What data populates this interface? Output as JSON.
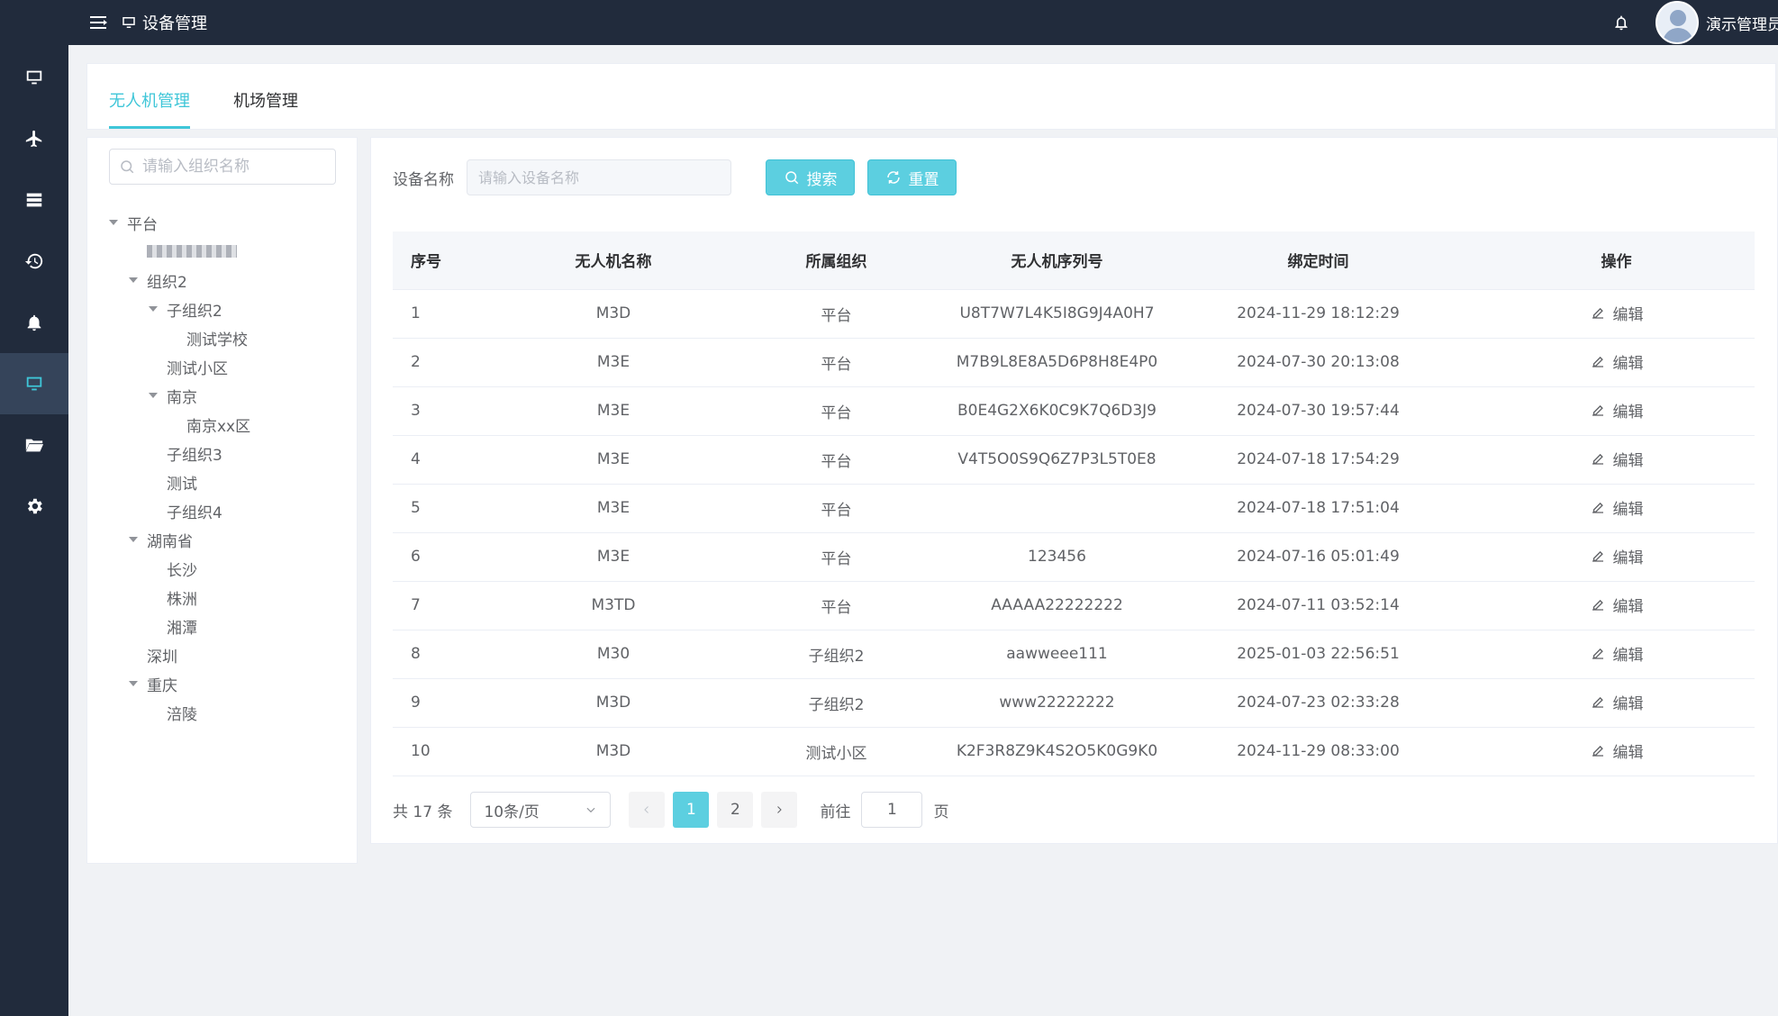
{
  "header": {
    "breadcrumb": "设备管理",
    "username": "演示管理员",
    "icons": [
      "hamburger-icon",
      "monitor-icon",
      "bell-icon",
      "avatar"
    ]
  },
  "sidebar": {
    "items": [
      {
        "icon": "monitor-icon",
        "active": false
      },
      {
        "icon": "plane-icon",
        "active": false
      },
      {
        "icon": "server-icon",
        "active": false
      },
      {
        "icon": "history-icon",
        "active": false
      },
      {
        "icon": "bell-icon",
        "active": false
      },
      {
        "icon": "device-icon",
        "active": true
      },
      {
        "icon": "folder-icon",
        "active": false
      },
      {
        "icon": "gear-icon",
        "active": false
      }
    ]
  },
  "tabs": {
    "items": [
      {
        "label": "无人机管理",
        "active": true
      },
      {
        "label": "机场管理",
        "active": false
      }
    ]
  },
  "tree": {
    "search_placeholder": "请输入组织名称",
    "nodes": [
      {
        "label": "平台",
        "level": 0,
        "expanded": true
      },
      {
        "label": "",
        "level": 1,
        "expanded": false,
        "blurred": true
      },
      {
        "label": "组织2",
        "level": 1,
        "expanded": true
      },
      {
        "label": "子组织2",
        "level": 2,
        "expanded": true
      },
      {
        "label": "测试学校",
        "level": 3
      },
      {
        "label": "测试小区",
        "level": 2
      },
      {
        "label": "南京",
        "level": 2,
        "expanded": true
      },
      {
        "label": "南京xx区",
        "level": 3
      },
      {
        "label": "子组织3",
        "level": 2
      },
      {
        "label": "测试",
        "level": 2
      },
      {
        "label": "子组织4",
        "level": 2
      },
      {
        "label": "湖南省",
        "level": 1,
        "expanded": true
      },
      {
        "label": "长沙",
        "level": 2
      },
      {
        "label": "株洲",
        "level": 2
      },
      {
        "label": "湘潭",
        "level": 2
      },
      {
        "label": "深圳",
        "level": 1
      },
      {
        "label": "重庆",
        "level": 1,
        "expanded": true
      },
      {
        "label": "涪陵",
        "level": 2
      }
    ]
  },
  "filter": {
    "label": "设备名称",
    "placeholder": "请输入设备名称",
    "search_label": "搜索",
    "reset_label": "重置"
  },
  "table": {
    "columns": [
      "序号",
      "无人机名称",
      "所属组织",
      "无人机序列号",
      "绑定时间",
      "操作"
    ],
    "edit_label": "编辑",
    "rows": [
      {
        "idx": "1",
        "name": "M3D",
        "org": "平台",
        "serial": "U8T7W7L4K5I8G9J4A0H7",
        "time": "2024-11-29 18:12:29"
      },
      {
        "idx": "2",
        "name": "M3E",
        "org": "平台",
        "serial": "M7B9L8E8A5D6P8H8E4P0",
        "time": "2024-07-30 20:13:08"
      },
      {
        "idx": "3",
        "name": "M3E",
        "org": "平台",
        "serial": "B0E4G2X6K0C9K7Q6D3J9",
        "time": "2024-07-30 19:57:44"
      },
      {
        "idx": "4",
        "name": "M3E",
        "org": "平台",
        "serial": "V4T5O0S9Q6Z7P3L5T0E8",
        "time": "2024-07-18 17:54:29"
      },
      {
        "idx": "5",
        "name": "M3E",
        "org": "平台",
        "serial": "",
        "time": "2024-07-18 17:51:04"
      },
      {
        "idx": "6",
        "name": "M3E",
        "org": "平台",
        "serial": "123456",
        "time": "2024-07-16 05:01:49"
      },
      {
        "idx": "7",
        "name": "M3TD",
        "org": "平台",
        "serial": "AAAAA22222222",
        "time": "2024-07-11 03:52:14"
      },
      {
        "idx": "8",
        "name": "M30",
        "org": "子组织2",
        "serial": "aawweee111",
        "time": "2025-01-03 22:56:51"
      },
      {
        "idx": "9",
        "name": "M3D",
        "org": "子组织2",
        "serial": "www22222222",
        "time": "2024-07-23 02:33:28"
      },
      {
        "idx": "10",
        "name": "M3D",
        "org": "测试小区",
        "serial": "K2F3R8Z9K4S2O5K0G9K0",
        "time": "2024-11-29 08:33:00"
      }
    ]
  },
  "pager": {
    "total_text": "共 17 条",
    "page_size": "10条/页",
    "pages": [
      "1",
      "2"
    ],
    "current_page": "1",
    "goto_label": "前往",
    "goto_value": "1",
    "page_suffix": "页"
  },
  "colors": {
    "accent": "#3fc6d8",
    "sidebar_bg": "#212b3c"
  }
}
